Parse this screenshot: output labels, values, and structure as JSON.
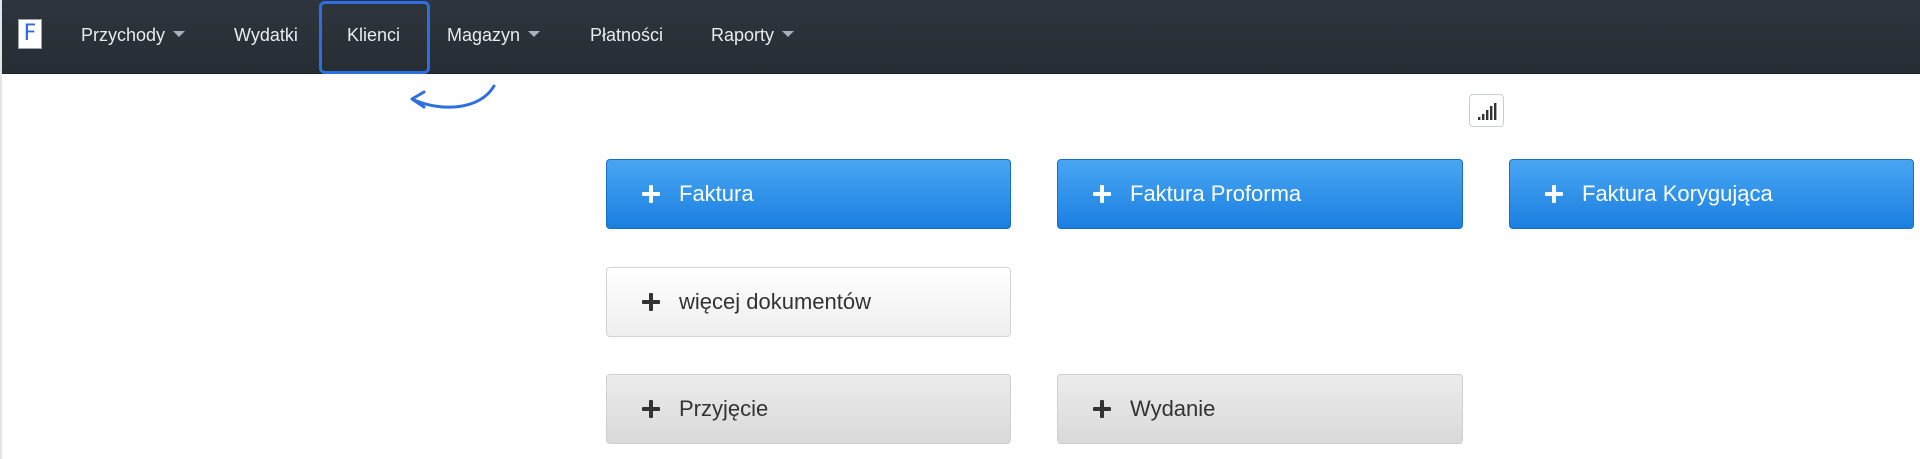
{
  "navbar": {
    "brand_letter": "F",
    "items": [
      {
        "label": "Przychody",
        "dropdown": true
      },
      {
        "label": "Wydatki",
        "dropdown": false
      },
      {
        "label": "Klienci",
        "dropdown": false,
        "highlighted": true
      },
      {
        "label": "Magazyn",
        "dropdown": true
      },
      {
        "label": "Płatności",
        "dropdown": false
      },
      {
        "label": "Raporty",
        "dropdown": true
      }
    ]
  },
  "icons": {
    "stats": "bar-chart-icon",
    "annotation": "curved-arrow-icon",
    "add": "plus-icon"
  },
  "colors": {
    "navbar_bg": "#2b3238",
    "highlight": "#2f6ee0",
    "primary": "#1e88e5",
    "default_text": "#333333"
  },
  "buttons": {
    "invoice": "Faktura",
    "proforma": "Faktura Proforma",
    "correction": "Faktura Korygująca",
    "more_documents": "więcej dokumentów",
    "receipt": "Przyjęcie",
    "issue": "Wydanie"
  }
}
